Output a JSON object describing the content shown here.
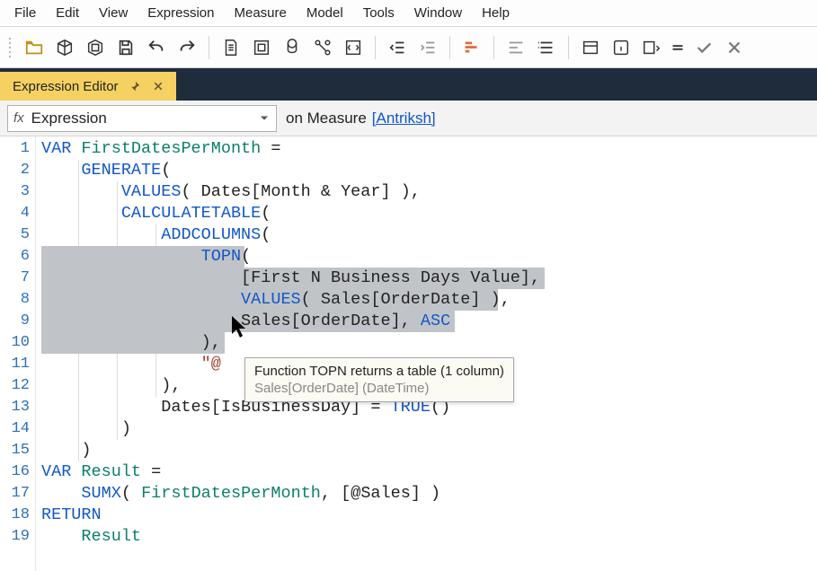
{
  "menu": {
    "items": [
      "File",
      "Edit",
      "View",
      "Expression",
      "Measure",
      "Model",
      "Tools",
      "Window",
      "Help"
    ]
  },
  "tab": {
    "title": "Expression Editor"
  },
  "formulaBar": {
    "fx": "fx",
    "combo_value": "Expression",
    "context_prefix": "on Measure",
    "context_link": "[Antriksh]"
  },
  "code": {
    "lines": [
      {
        "n": 1,
        "segments": [
          {
            "t": "VAR ",
            "c": "kw"
          },
          {
            "t": "FirstDatesPerMonth",
            "c": "var"
          },
          {
            "t": " =",
            "c": "txt"
          }
        ]
      },
      {
        "n": 2,
        "segments": [
          {
            "t": "    ",
            "c": "txt"
          },
          {
            "t": "GENERATE",
            "c": "fn"
          },
          {
            "t": "(",
            "c": "txt"
          }
        ]
      },
      {
        "n": 3,
        "segments": [
          {
            "t": "        ",
            "c": "txt"
          },
          {
            "t": "VALUES",
            "c": "fn"
          },
          {
            "t": "( Dates[Month & Year] ),",
            "c": "txt"
          }
        ]
      },
      {
        "n": 4,
        "segments": [
          {
            "t": "        ",
            "c": "txt"
          },
          {
            "t": "CALCULATETABLE",
            "c": "fn"
          },
          {
            "t": "(",
            "c": "txt"
          }
        ]
      },
      {
        "n": 5,
        "segments": [
          {
            "t": "            ",
            "c": "txt"
          },
          {
            "t": "ADDCOLUMNS",
            "c": "fn"
          },
          {
            "t": "(",
            "c": "txt"
          }
        ]
      },
      {
        "n": 6,
        "segments": [
          {
            "t": "                ",
            "c": "txt"
          },
          {
            "t": "TOPN",
            "c": "fn"
          },
          {
            "t": "(",
            "c": "txt"
          }
        ]
      },
      {
        "n": 7,
        "segments": [
          {
            "t": "                    [First N Business Days Value],",
            "c": "txt"
          }
        ]
      },
      {
        "n": 8,
        "segments": [
          {
            "t": "                    ",
            "c": "txt"
          },
          {
            "t": "VALUES",
            "c": "fn"
          },
          {
            "t": "( Sales[OrderDate] ),",
            "c": "txt"
          }
        ]
      },
      {
        "n": 9,
        "segments": [
          {
            "t": "                    Sales[OrderDate], ",
            "c": "txt"
          },
          {
            "t": "ASC",
            "c": "asc"
          }
        ]
      },
      {
        "n": 10,
        "segments": [
          {
            "t": "                ),",
            "c": "txt"
          }
        ]
      },
      {
        "n": 11,
        "segments": [
          {
            "t": "                ",
            "c": "txt"
          },
          {
            "t": "\"@",
            "c": "str"
          }
        ]
      },
      {
        "n": 12,
        "segments": [
          {
            "t": "            ),",
            "c": "txt"
          }
        ]
      },
      {
        "n": 13,
        "segments": [
          {
            "t": "            Dates[IsBusinessDay] = ",
            "c": "txt"
          },
          {
            "t": "TRUE",
            "c": "fn"
          },
          {
            "t": "()",
            "c": "txt"
          }
        ]
      },
      {
        "n": 14,
        "segments": [
          {
            "t": "        )",
            "c": "txt"
          }
        ]
      },
      {
        "n": 15,
        "segments": [
          {
            "t": "    )",
            "c": "txt"
          }
        ]
      },
      {
        "n": 16,
        "segments": [
          {
            "t": "VAR ",
            "c": "kw"
          },
          {
            "t": "Result",
            "c": "var"
          },
          {
            "t": " =",
            "c": "txt"
          }
        ]
      },
      {
        "n": 17,
        "segments": [
          {
            "t": "    ",
            "c": "txt"
          },
          {
            "t": "SUMX",
            "c": "fn"
          },
          {
            "t": "( ",
            "c": "txt"
          },
          {
            "t": "FirstDatesPerMonth",
            "c": "var"
          },
          {
            "t": ", [@Sales] )",
            "c": "txt"
          }
        ]
      },
      {
        "n": 18,
        "segments": [
          {
            "t": "RETURN",
            "c": "ret"
          }
        ]
      },
      {
        "n": 19,
        "segments": [
          {
            "t": "    ",
            "c": "txt"
          },
          {
            "t": "Result",
            "c": "var"
          }
        ]
      }
    ]
  },
  "tooltip": {
    "line1": "Function TOPN returns a table (1 column)",
    "line2": "Sales[OrderDate] (DateTime)"
  }
}
